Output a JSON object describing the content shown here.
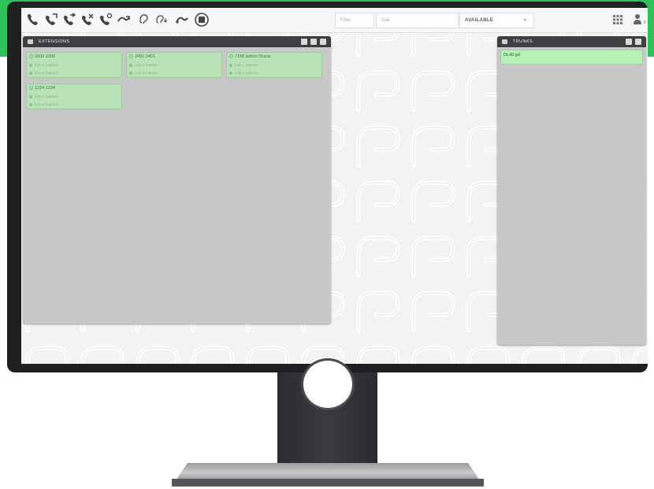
{
  "colors": {
    "brand_green": "#2ec05a",
    "bezel": "#1f2022",
    "panel_header": "#3d3f42",
    "card_green": "#b9e2b9",
    "trunk_green": "#b6f1b6"
  },
  "toolbar": {
    "icons": [
      "phone-call-icon",
      "phone-forward-icon",
      "phone-transfer-icon",
      "phone-park-icon",
      "phone-pickup-icon",
      "call-merge-icon",
      "listen-ear-icon",
      "whisper-icon",
      "call-redirect-icon",
      "record-icon"
    ],
    "filter_placeholder": "Filter",
    "dial_placeholder": "Dial",
    "status_value": "AVAILABLE"
  },
  "extensions_panel": {
    "title": "EXTENSIONS",
    "cards": [
      {
        "title": "2000 2000",
        "lines": [
          "Line 1 Inactive",
          "Line 2 Inactive"
        ]
      },
      {
        "title": "2451 2451",
        "lines": [
          "Line 1 Inactive",
          "Line 2 Inactive"
        ]
      },
      {
        "title": "7150 admin Drana",
        "lines": [
          "Line 1 Inactive",
          "Line 2 Inactive"
        ]
      },
      {
        "title": "1234 1234",
        "lines": [
          "Line 1 Inactive",
          "Line 2 Inactive"
        ]
      }
    ]
  },
  "trunks_panel": {
    "title": "TRUNKS",
    "rows": [
      "DL40.gd"
    ]
  }
}
